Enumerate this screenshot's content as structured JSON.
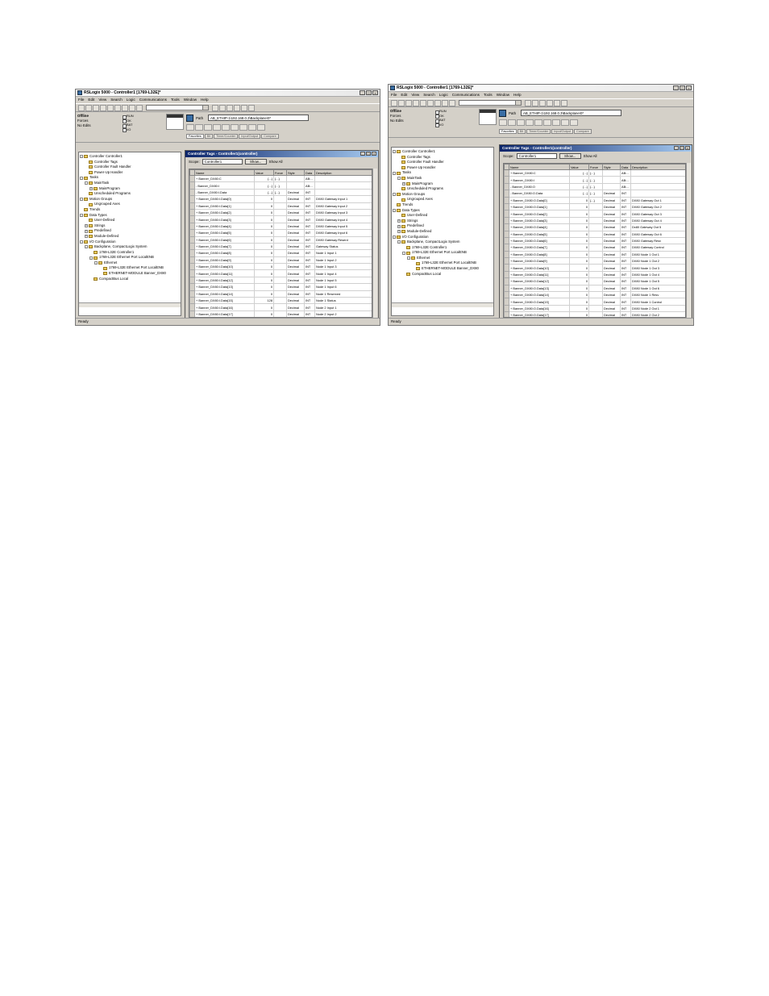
{
  "screenshots": [
    {
      "id": "shot1",
      "title": "RSLogix 5000 - Controller1 [1769-L32E]*",
      "menu": [
        "File",
        "Edit",
        "View",
        "Search",
        "Logic",
        "Communications",
        "Tools",
        "Window",
        "Help"
      ],
      "status": {
        "mode": "Offline",
        "forces": "Forces",
        "edits": "No Edits",
        "indicators": [
          "RUN",
          "OK",
          "BAT",
          "I/O"
        ]
      },
      "path_label": "Path",
      "path_value": "AB_ETHIP-1\\192.168.0.3\\Backplane\\0*",
      "inst_tabs": [
        "Favorites",
        "Bit",
        "Timer/Counter",
        "Input/Output",
        "Compare"
      ],
      "tree": [
        {
          "d": 0,
          "t": "-",
          "label": "Controller Controller1"
        },
        {
          "d": 1,
          "t": "",
          "label": "Controller Tags"
        },
        {
          "d": 1,
          "t": "",
          "label": "Controller Fault Handler"
        },
        {
          "d": 1,
          "t": "",
          "label": "Power-Up Handler"
        },
        {
          "d": 0,
          "t": "-",
          "label": "Tasks"
        },
        {
          "d": 1,
          "t": "-",
          "label": "MainTask"
        },
        {
          "d": 2,
          "t": "+",
          "label": "MainProgram"
        },
        {
          "d": 1,
          "t": "",
          "label": "Unscheduled Programs"
        },
        {
          "d": 0,
          "t": "-",
          "label": "Motion Groups"
        },
        {
          "d": 1,
          "t": "",
          "label": "Ungrouped Axes"
        },
        {
          "d": 0,
          "t": "",
          "label": "Trends"
        },
        {
          "d": 0,
          "t": "-",
          "label": "Data Types"
        },
        {
          "d": 1,
          "t": "",
          "label": "User-Defined"
        },
        {
          "d": 1,
          "t": "+",
          "label": "Strings"
        },
        {
          "d": 1,
          "t": "+",
          "label": "Predefined"
        },
        {
          "d": 1,
          "t": "+",
          "label": "Module-Defined"
        },
        {
          "d": 0,
          "t": "-",
          "label": "I/O Configuration"
        },
        {
          "d": 1,
          "t": "-",
          "label": "Backplane, CompactLogix System"
        },
        {
          "d": 2,
          "t": "",
          "label": "1769-L32E Controller1"
        },
        {
          "d": 2,
          "t": "-",
          "label": "1769-L32E Ethernet Port LocalENB"
        },
        {
          "d": 3,
          "t": "-",
          "label": "Ethernet"
        },
        {
          "d": 4,
          "t": "",
          "label": "1769-L32E Ethernet Port LocalENB"
        },
        {
          "d": 4,
          "t": "",
          "label": "ETHERNET-MODULE Banner_DX80"
        },
        {
          "d": 2,
          "t": "",
          "label": "CompactBus Local"
        }
      ],
      "tag_window_title": "Controller Tags - Controller1(controller)",
      "scope_label": "Scope:",
      "scope_value": "Controller1",
      "show_button": "Show...",
      "show_value": "Show All",
      "columns": [
        "Name",
        "Value",
        "Force",
        "Style",
        "Data",
        "Description"
      ],
      "rows": [
        [
          "+ Banner_DX80:C",
          "{...}",
          "{...}",
          "",
          "AB:...",
          ""
        ],
        [
          "- Banner_DX80:I",
          "{...}",
          "{...}",
          "",
          "AB:...",
          ""
        ],
        [
          "- Banner_DX80:I.Data",
          "{...}",
          "{...}",
          "Decimal",
          "INT",
          "",
          ""
        ],
        [
          "+ Banner_DX80:I.Data[0]",
          "0",
          "",
          "Decimal",
          "INT",
          "DX80 Gateway Input 1"
        ],
        [
          "+ Banner_DX80:I.Data[1]",
          "0",
          "",
          "Decimal",
          "INT",
          "DX80 Gateway Input 2"
        ],
        [
          "+ Banner_DX80:I.Data[2]",
          "0",
          "",
          "Decimal",
          "INT",
          "DX80 Gateway Input 3"
        ],
        [
          "+ Banner_DX80:I.Data[3]",
          "0",
          "",
          "Decimal",
          "INT",
          "DX80 Gateway Input 4"
        ],
        [
          "+ Banner_DX80:I.Data[4]",
          "0",
          "",
          "Decimal",
          "INT",
          "DX80 Gateway Input 5"
        ],
        [
          "+ Banner_DX80:I.Data[5]",
          "0",
          "",
          "Decimal",
          "INT",
          "DX80 Gateway Input 6"
        ],
        [
          "+ Banner_DX80:I.Data[6]",
          "0",
          "",
          "Decimal",
          "INT",
          "DX80 Gateway Reserd"
        ],
        [
          "+ Banner_DX80:I.Data[7]",
          "0",
          "",
          "Decimal",
          "INT",
          "Gateway Status"
        ],
        [
          "+ Banner_DX80:I.Data[8]",
          "0",
          "",
          "Decimal",
          "INT",
          "Node 1 Input 1"
        ],
        [
          "+ Banner_DX80:I.Data[9]",
          "0",
          "",
          "Decimal",
          "INT",
          "Node 1 Input 2"
        ],
        [
          "+ Banner_DX80:I.Data[10]",
          "0",
          "",
          "Decimal",
          "INT",
          "Node 1 Input 3"
        ],
        [
          "+ Banner_DX80:I.Data[11]",
          "0",
          "",
          "Decimal",
          "INT",
          "Node 1 Input 4"
        ],
        [
          "+ Banner_DX80:I.Data[12]",
          "0",
          "",
          "Decimal",
          "INT",
          "Node 1 Input 5"
        ],
        [
          "+ Banner_DX80:I.Data[13]",
          "0",
          "",
          "Decimal",
          "INT",
          "Node 1 Input 6"
        ],
        [
          "+ Banner_DX80:I.Data[14]",
          "0",
          "",
          "Decimal",
          "INT",
          "Node 1 Reserved"
        ],
        [
          "+ Banner_DX80:I.Data[15]",
          "128",
          "",
          "Decimal",
          "INT",
          "Node 1 Status"
        ],
        [
          "+ Banner_DX80:I.Data[16]",
          "0",
          "",
          "Decimal",
          "INT",
          "Node 2 Input 1"
        ],
        [
          "+ Banner_DX80:I.Data[17]",
          "0",
          "",
          "Decimal",
          "INT",
          "Node 2 Input 2"
        ]
      ],
      "status_bar": "Ready"
    },
    {
      "id": "shot2",
      "title": "RSLogix 5000 - Controller1 [1769-L32E]*",
      "menu": [
        "File",
        "Edit",
        "View",
        "Search",
        "Logic",
        "Communications",
        "Tools",
        "Window",
        "Help"
      ],
      "status": {
        "mode": "Offline",
        "forces": "Forces",
        "edits": "No Edits",
        "indicators": [
          "RUN",
          "OK",
          "BAT",
          "I/O"
        ]
      },
      "path_label": "Path",
      "path_value": "AB_ETHIP-1\\192.168.0.3\\Backplane\\0*",
      "inst_tabs": [
        "Favorites",
        "Bit",
        "Timer/Counter",
        "Input/Output",
        "Compare"
      ],
      "tree": [
        {
          "d": 0,
          "t": "-",
          "label": "Controller Controller1"
        },
        {
          "d": 1,
          "t": "",
          "label": "Controller Tags"
        },
        {
          "d": 1,
          "t": "",
          "label": "Controller Fault Handler"
        },
        {
          "d": 1,
          "t": "",
          "label": "Power-Up Handler"
        },
        {
          "d": 0,
          "t": "-",
          "label": "Tasks"
        },
        {
          "d": 1,
          "t": "-",
          "label": "MainTask"
        },
        {
          "d": 2,
          "t": "+",
          "label": "MainProgram"
        },
        {
          "d": 1,
          "t": "",
          "label": "Unscheduled Programs"
        },
        {
          "d": 0,
          "t": "-",
          "label": "Motion Groups"
        },
        {
          "d": 1,
          "t": "",
          "label": "Ungrouped Axes"
        },
        {
          "d": 0,
          "t": "",
          "label": "Trends"
        },
        {
          "d": 0,
          "t": "-",
          "label": "Data Types"
        },
        {
          "d": 1,
          "t": "",
          "label": "User-Defined"
        },
        {
          "d": 1,
          "t": "+",
          "label": "Strings"
        },
        {
          "d": 1,
          "t": "+",
          "label": "Predefined"
        },
        {
          "d": 1,
          "t": "+",
          "label": "Module-Defined"
        },
        {
          "d": 0,
          "t": "-",
          "label": "I/O Configuration"
        },
        {
          "d": 1,
          "t": "-",
          "label": "Backplane, CompactLogix System"
        },
        {
          "d": 2,
          "t": "",
          "label": "1769-L32E Controller1"
        },
        {
          "d": 2,
          "t": "-",
          "label": "1769-L32E Ethernet Port LocalENB"
        },
        {
          "d": 3,
          "t": "-",
          "label": "Ethernet"
        },
        {
          "d": 4,
          "t": "",
          "label": "1769-L32E Ethernet Port LocalENB"
        },
        {
          "d": 4,
          "t": "",
          "label": "ETHERNET-MODULE Banner_DX80"
        },
        {
          "d": 2,
          "t": "",
          "label": "CompactBus Local"
        }
      ],
      "tag_window_title": "Controller Tags - Controller1(controller)",
      "scope_label": "Scope:",
      "scope_value": "Controller1",
      "show_button": "Show...",
      "show_value": "Show All",
      "columns": [
        "Name",
        "Value",
        "Force",
        "Style",
        "Data",
        "Description"
      ],
      "rows": [
        [
          "+ Banner_DX80:C",
          "{...}",
          "{...}",
          "",
          "AB:...",
          ""
        ],
        [
          "+ Banner_DX80:I",
          "{...}",
          "{...}",
          "",
          "AB:...",
          ""
        ],
        [
          "- Banner_DX80:O",
          "{...}",
          "{...}",
          "",
          "AB:...",
          ""
        ],
        [
          "- Banner_DX80:O.Data",
          "{...}",
          "{...}",
          "Decimal",
          "INT",
          ""
        ],
        [
          "+ Banner_DX80:O.Data[0]",
          "0",
          "{...}",
          "Decimal",
          "INT",
          "DX80 Gateway Out 1"
        ],
        [
          "+ Banner_DX80:O.Data[1]",
          "0",
          "",
          "Decimal",
          "INT",
          "DX80 Gateway Out 2"
        ],
        [
          "+ Banner_DX80:O.Data[2]",
          "0",
          "",
          "Decimal",
          "INT",
          "DX80 Gateway Out 3"
        ],
        [
          "+ Banner_DX80:O.Data[3]",
          "0",
          "",
          "Decimal",
          "INT",
          "DX80 Gateway Out 4"
        ],
        [
          "+ Banner_DX80:O.Data[4]",
          "0",
          "",
          "Decimal",
          "INT",
          "Dx80 Gateway Out 5"
        ],
        [
          "+ Banner_DX80:O.Data[5]",
          "0",
          "",
          "Decimal",
          "INT",
          "DX80 Gateway Out 6"
        ],
        [
          "+ Banner_DX80:O.Data[6]",
          "0",
          "",
          "Decimal",
          "INT",
          "DX80 Gateway Resv"
        ],
        [
          "+ Banner_DX80:O.Data[7]",
          "0",
          "",
          "Decimal",
          "INT",
          "DX80 Gateway Control"
        ],
        [
          "+ Banner_DX80:O.Data[8]",
          "0",
          "",
          "Decimal",
          "INT",
          "DX80 Node 1 Out 1"
        ],
        [
          "+ Banner_DX80:O.Data[9]",
          "0",
          "",
          "Decimal",
          "INT",
          "DX80 Node 1 Out 2"
        ],
        [
          "+ Banner_DX80:O.Data[10]",
          "0",
          "",
          "Decimal",
          "INT",
          "DX80 Node 1 Out 3"
        ],
        [
          "+ Banner_DX80:O.Data[11]",
          "0",
          "",
          "Decimal",
          "INT",
          "DX80 Node 1 Out 4"
        ],
        [
          "+ Banner_DX80:O.Data[12]",
          "0",
          "",
          "Decimal",
          "INT",
          "DX80 Node 1 Out 5"
        ],
        [
          "+ Banner_DX80:O.Data[13]",
          "0",
          "",
          "Decimal",
          "INT",
          "DX80 Node 1 Out 6"
        ],
        [
          "+ Banner_DX80:O.Data[14]",
          "0",
          "",
          "Decimal",
          "INT",
          "DX80 Node 1 Resv"
        ],
        [
          "+ Banner_DX80:O.Data[15]",
          "0",
          "",
          "Decimal",
          "INT",
          "DX80 Node 1 Control"
        ],
        [
          "+ Banner_DX80:O.Data[16]",
          "0",
          "",
          "Decimal",
          "INT",
          "DX80 Node 2 Out 1"
        ],
        [
          "+ Banner_DX80:O.Data[17]",
          "0",
          "",
          "Decimal",
          "INT",
          "DX80 Node 2 Out 2"
        ]
      ],
      "status_bar": "Ready"
    }
  ]
}
